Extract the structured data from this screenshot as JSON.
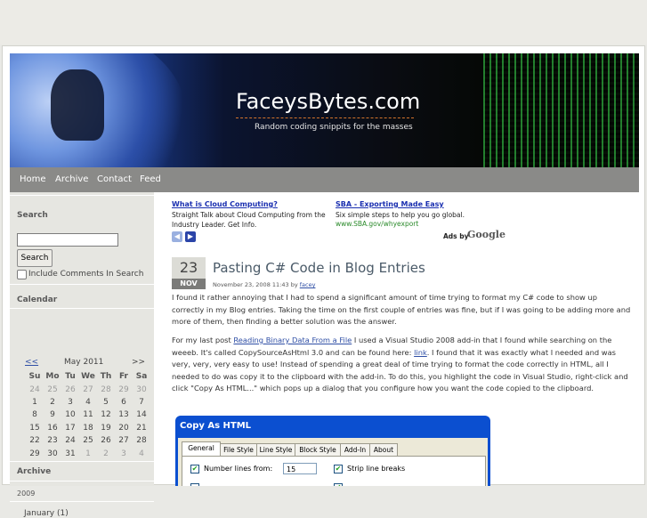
{
  "site": {
    "title": "FaceysBytes.com",
    "tagline": "Random coding snippits for the masses"
  },
  "nav": [
    "Home",
    "Archive",
    "Contact",
    "Feed"
  ],
  "sidebar": {
    "search_heading": "Search",
    "search_value": "",
    "search_button": "Search",
    "include_comments_label": "Include Comments In Search",
    "calendar_heading": "Calendar",
    "calendar": {
      "prev": "<<",
      "month": "May 2011",
      "next": ">>",
      "days_of_week": [
        "Su",
        "Mo",
        "Tu",
        "We",
        "Th",
        "Fr",
        "Sa"
      ],
      "weeks": [
        [
          "24",
          "25",
          "26",
          "27",
          "28",
          "29",
          "30"
        ],
        [
          "1",
          "2",
          "3",
          "4",
          "5",
          "6",
          "7"
        ],
        [
          "8",
          "9",
          "10",
          "11",
          "12",
          "13",
          "14"
        ],
        [
          "15",
          "16",
          "17",
          "18",
          "19",
          "20",
          "21"
        ],
        [
          "22",
          "23",
          "24",
          "25",
          "26",
          "27",
          "28"
        ],
        [
          "29",
          "30",
          "31",
          "1",
          "2",
          "3",
          "4"
        ]
      ]
    },
    "archive_heading": "Archive",
    "archive_year": "2009",
    "archive_month": "January (1)"
  },
  "ads": {
    "items": [
      {
        "title": "What is Cloud Computing?",
        "desc": "Straight Talk about Cloud Computing from the Industry Leader. Get Info.",
        "url": ""
      },
      {
        "title": "SBA - Exporting Made Easy",
        "desc": "Six simple steps to help you go global.",
        "url": "www.SBA.gov/whyexport"
      }
    ],
    "ads_by": "Ads by",
    "google": "Google"
  },
  "post": {
    "day": "23",
    "month": "NOV",
    "title": "Pasting C# Code in Blog Entries",
    "meta": "November 23, 2008 11:43 by",
    "author": "facey",
    "p1": "I found it rather annoying that I had to spend a significant amount of time trying to format my C# code to show up correctly in my Blog entries.  Taking the time on the first couple of entries was fine, but if I was going to be adding more and more of them, then finding a better solution was the answer.",
    "p2_a": "For my last post ",
    "p2_link": "Reading Binary Data From a File",
    "p2_b": " I used a Visual Studio 2008 add-in that I found while searching on the weeeb.  It's called CopySourceAsHtml 3.0 and can be found here: ",
    "p2_link2": "link",
    "p2_c": ". I found that it was exactly what I needed and was very, very, very easy to use!  Instead of spending a great deal of time trying to format the code correctly in HTML, all I needed to do was copy it to the clipboard with the add-in.  To do this, you highlight the code in Visual Studio, right-click and click \"Copy As HTML...\" which pops up a dialog that you configure how you want the code copied to the clipboard."
  },
  "dialog": {
    "title": "Copy As HTML",
    "tabs": [
      "General",
      "File Style",
      "Line Style",
      "Block Style",
      "Add-In",
      "About"
    ],
    "number_lines_label": "Number lines from:",
    "number_lines_value": "15",
    "strip_breaks_label": "Strip line breaks"
  }
}
